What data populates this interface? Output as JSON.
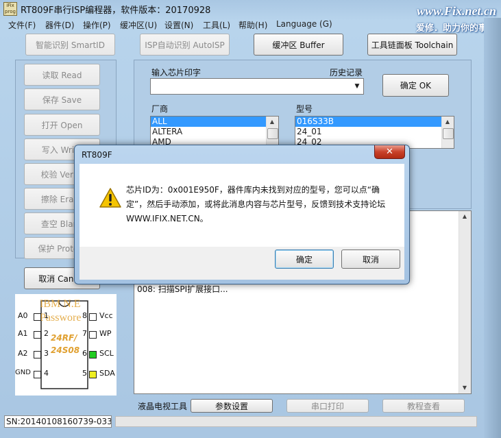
{
  "window": {
    "title": "RT809F串行ISP编程器，软件版本：20170928",
    "icon_text": "iFix prog"
  },
  "watermark": {
    "url": "www.Fix.net.cn",
    "slogan": "爱修．助力你的事业"
  },
  "menu": [
    "文件(F)",
    "器件(D)",
    "操作(P)",
    "缓冲区(U)",
    "设置(N)",
    "工具(L)",
    "帮助(H)",
    "Language (G)"
  ],
  "toolbar": {
    "smart_id": "智能识别 SmartID",
    "auto_isp": "ISP自动识别 AutoISP",
    "buffer": "缓冲区 Buffer",
    "toolchain": "工具链面板 Toolchain"
  },
  "ops": {
    "read": "读取 Read",
    "save": "保存 Save",
    "open": "打开 Open",
    "write": "写入 Write",
    "verify": "校验 Verify",
    "erase": "擦除 Erase",
    "blank": "查空 Blank",
    "protect": "保护 Protect",
    "cancel": "取消 Cancel"
  },
  "chip": {
    "input_label": "输入芯片印字",
    "history_label": "历史记录",
    "input_value": "",
    "ok": "确定 OK",
    "vendor_label": "厂商",
    "model_label": "型号",
    "vendors": [
      "ALL",
      "ALTERA",
      "AMD"
    ],
    "models": [
      "016S33B",
      "24_01",
      "24_02"
    ]
  },
  "log": {
    "line": "008: 扫描SPI扩展接口..."
  },
  "diagram": {
    "watermark_1": "IBM N.E",
    "watermark_2": "Passwore",
    "chip_text_1": "24RF/",
    "chip_text_2": "24S08",
    "pins_left": [
      "A0",
      "A1",
      "A2",
      "GND"
    ],
    "pins_right": [
      "Vcc",
      "WP",
      "SCL",
      "SDA"
    ],
    "pin_nums_left": [
      "1",
      "2",
      "3",
      "4"
    ],
    "pin_nums_right": [
      "8",
      "7",
      "6",
      "5"
    ],
    "colors": {
      "scl": "#22cc22",
      "sda": "#eeee22"
    }
  },
  "bottom": {
    "lcd_label": "液晶电视工具",
    "params": "参数设置",
    "serial_print": "串口打印",
    "tutorial": "教程查看"
  },
  "status": {
    "sn": "SN:20140108160739-0332"
  },
  "dialog": {
    "title": "RT809F",
    "close": "✕",
    "message": "芯片ID为：0x001E950F，器件库内未找到对应的型号，您可以点“确定”，然后手动添加，或将此消息内容与芯片型号，反馈到技术支持论坛WWW.IFIX.NET.CN。",
    "ok": "确定",
    "cancel": "取消"
  }
}
